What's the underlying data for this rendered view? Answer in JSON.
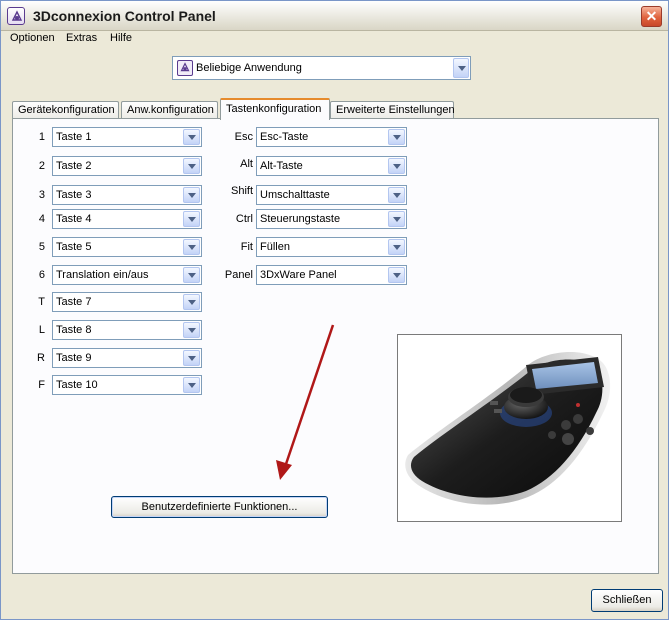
{
  "window": {
    "title": "3Dconnexion Control Panel",
    "close_glyph": "✕"
  },
  "menu": {
    "items": [
      {
        "label": "Optionen"
      },
      {
        "label": "Extras"
      },
      {
        "label": "Hilfe"
      }
    ]
  },
  "app_selector": {
    "value": "Beliebige Anwendung",
    "icon": "3dconnexion-app-icon"
  },
  "tabs": [
    {
      "label": "Gerätekonfiguration",
      "active": false
    },
    {
      "label": "Anw.konfiguration",
      "active": false
    },
    {
      "label": "Tastenkonfiguration",
      "active": true
    },
    {
      "label": "Erweiterte Einstellungen",
      "active": false
    }
  ],
  "left_buttons": [
    {
      "label": "1",
      "value": "Taste 1"
    },
    {
      "label": "2",
      "value": "Taste 2"
    },
    {
      "label": "3",
      "value": "Taste 3"
    },
    {
      "label": "4",
      "value": "Taste 4"
    },
    {
      "label": "5",
      "value": "Taste 5"
    },
    {
      "label": "6",
      "value": "Translation ein/aus"
    },
    {
      "label": "T",
      "value": "Taste 7"
    },
    {
      "label": "L",
      "value": "Taste 8"
    },
    {
      "label": "R",
      "value": "Taste 9"
    },
    {
      "label": "F",
      "value": "Taste 10"
    }
  ],
  "right_buttons": [
    {
      "label": "Esc",
      "value": "Esc-Taste"
    },
    {
      "label": "Alt",
      "value": "Alt-Taste"
    },
    {
      "label": "Shift",
      "value": "Umschalttaste"
    },
    {
      "label": "Ctrl",
      "value": "Steuerungstaste"
    },
    {
      "label": "Fit",
      "value": "Füllen"
    },
    {
      "label": "Panel",
      "value": "3DxWare Panel"
    }
  ],
  "custom_functions_button": "Benutzerdefinierte Funktionen...",
  "close_button": "Schließen",
  "colors": {
    "window_bg": "#ece9d8",
    "active_tab_accent": "#e68b2c",
    "annotation_arrow": "#b01818",
    "button_border": "#003c74"
  }
}
